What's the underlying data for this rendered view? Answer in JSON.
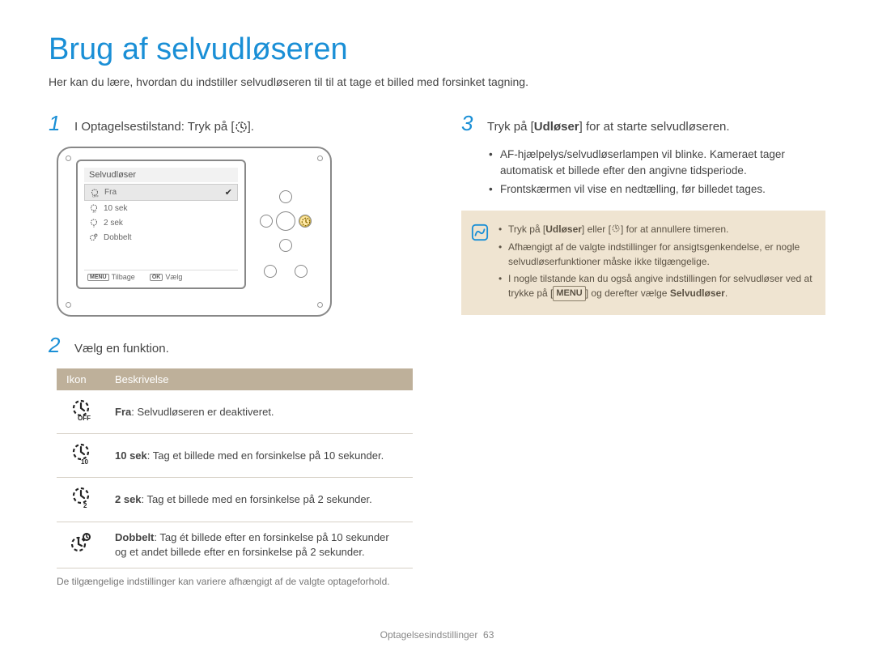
{
  "title": "Brug af selvudløseren",
  "subtitle": "Her kan du lære, hvordan du indstiller selvudløseren til til at tage et billed med forsinket tagning.",
  "steps": {
    "s1": {
      "num": "1",
      "text_before": "I Optagelsestilstand: Tryk på [",
      "text_after": "]."
    },
    "s2": {
      "num": "2",
      "text": "Vælg en funktion."
    },
    "s3": {
      "num": "3",
      "text_before": "Tryk på [",
      "shutter": "Udløser",
      "text_after": "] for at starte selvudløseren."
    }
  },
  "camera_menu": {
    "title": "Selvudløser",
    "items": [
      {
        "label": "Fra",
        "icon": "timer-off",
        "selected": true
      },
      {
        "label": "10 sek",
        "icon": "timer-10"
      },
      {
        "label": "2 sek",
        "icon": "timer-2"
      },
      {
        "label": "Dobbelt",
        "icon": "timer-double"
      }
    ],
    "footer": {
      "menu_badge": "MENU",
      "back": "Tilbage",
      "ok_badge": "OK",
      "select": "Vælg"
    }
  },
  "table": {
    "header": {
      "icon": "Ikon",
      "desc": "Beskrivelse"
    },
    "rows": [
      {
        "icon_name": "timer-off-icon",
        "bold": "Fra",
        "rest": ": Selvudløseren er deaktiveret."
      },
      {
        "icon_name": "timer-10-icon",
        "bold": "10 sek",
        "rest": ": Tag et billede med en forsinkelse på 10 sekunder."
      },
      {
        "icon_name": "timer-2-icon",
        "bold": "2 sek",
        "rest": ": Tag et billede med en forsinkelse på 2 sekunder."
      },
      {
        "icon_name": "timer-double-icon",
        "bold": "Dobbelt",
        "rest": ": Tag ét billede efter en forsinkelse på 10 sekunder og et andet billede efter en forsinkelse på 2 sekunder."
      }
    ],
    "note": "De tilgængelige indstillinger kan variere afhængigt af de valgte optageforhold."
  },
  "right_bullets": [
    "AF-hjælpelys/selvudløserlampen vil blinke. Kameraet tager automatisk et billede efter den angivne tidsperiode.",
    "Frontskærmen vil vise en nedtælling, før billedet tages."
  ],
  "note_box": {
    "n1_a": "Tryk på [",
    "n1_shutter": "Udløser",
    "n1_b": "] eller [",
    "n1_c": "] for at annullere timeren.",
    "n2": "Afhængigt af de valgte indstillinger for ansigtsgenkendelse, er nogle selvudløserfunktioner måske ikke tilgængelige.",
    "n3_a": "I nogle tilstande kan du også angive indstillingen for selvudløser ved at trykke på [",
    "n3_menu": "MENU",
    "n3_b": "] og derefter vælge ",
    "n3_bold": "Selvudløser",
    "n3_c": "."
  },
  "footer": {
    "section": "Optagelsesindstillinger",
    "page": "63"
  }
}
